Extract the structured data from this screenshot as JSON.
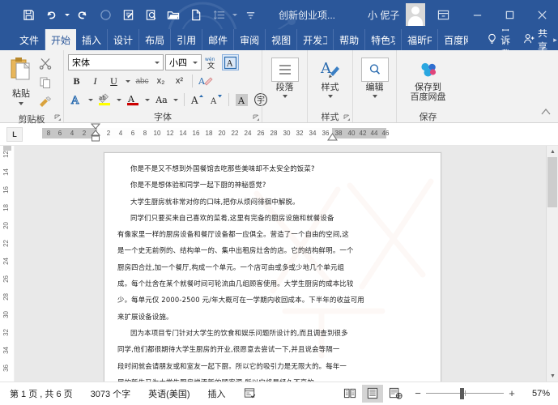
{
  "titlebar": {
    "quick_access": [
      {
        "name": "save-icon",
        "label": "保存"
      },
      {
        "name": "undo-icon",
        "label": "撤消"
      },
      {
        "name": "redo-icon",
        "label": "恢复"
      },
      {
        "name": "circle-icon",
        "label": "圆形"
      },
      {
        "name": "edit-doc-icon",
        "label": "编辑"
      },
      {
        "name": "print-preview-icon",
        "label": "打印预览"
      },
      {
        "name": "open-folder-icon",
        "label": "打开"
      },
      {
        "name": "new-doc-icon",
        "label": "新建"
      },
      {
        "name": "line-spacing-icon",
        "label": "行距"
      }
    ],
    "document_title": "创新创业项...",
    "user_name": "小 伲子",
    "avatar": "user-avatar",
    "ribbon_display_options": "ribbon-display-options-icon",
    "minimize": "−",
    "maximize": "□",
    "close": "✕"
  },
  "tabs": [
    {
      "label": "文件",
      "active": false
    },
    {
      "label": "开始",
      "active": true
    },
    {
      "label": "插入",
      "active": false
    },
    {
      "label": "设计",
      "active": false
    },
    {
      "label": "布局",
      "active": false
    },
    {
      "label": "引用",
      "active": false
    },
    {
      "label": "邮件",
      "active": false
    },
    {
      "label": "审阅",
      "active": false
    },
    {
      "label": "视图",
      "active": false
    },
    {
      "label": "开发工具",
      "active": false
    },
    {
      "label": "帮助",
      "active": false
    },
    {
      "label": "特色功能",
      "active": false
    },
    {
      "label": "福昕PDF",
      "active": false
    },
    {
      "label": "百度网盘",
      "active": false
    }
  ],
  "tell_me": {
    "icon": "lightbulb-icon",
    "label": "告诉我"
  },
  "share": {
    "icon": "share-person-icon",
    "label": "共享"
  },
  "ribbon": {
    "clipboard": {
      "group_label": "剪贴板",
      "paste_label": "粘贴",
      "cut": "cut-scissors-icon",
      "copy": "copy-icon",
      "format_painter": "format-painter-icon",
      "dialog_launcher": "dialog-launcher-icon"
    },
    "font": {
      "group_label": "字体",
      "font_name": "宋体",
      "font_size": "小四",
      "phonetic_guide": "phonetic-guide-icon",
      "enclose_char_border": "character-border-icon",
      "bold": "B",
      "italic": "I",
      "underline": "U",
      "strikethrough": "abc",
      "subscript": "x₂",
      "superscript": "x²",
      "clear_format": "clear-formatting-icon",
      "text_effects": "A",
      "highlight": "ab",
      "font_color": "A",
      "change_case": "Aa",
      "grow_font": "A",
      "shrink_font": "A",
      "char_shading": "A",
      "enclose_char": "字",
      "dialog_launcher": "dialog-launcher-icon"
    },
    "paragraph": {
      "group_label": "",
      "button_label": "段落",
      "icon": "paragraph-lines-icon"
    },
    "styles": {
      "group_label": "样式",
      "button_label": "样式",
      "icon": "styles-brush-icon",
      "dialog_launcher": "dialog-launcher-icon"
    },
    "editing": {
      "group_label": "",
      "button_label": "编辑",
      "icon": "magnifier-icon"
    },
    "save_group": {
      "group_label": "保存",
      "button_label": "保存到\n百度网盘",
      "button_label_line1": "保存到",
      "button_label_line2": "百度网盘",
      "icon": "baidu-netdisk-icon"
    },
    "collapse_ribbon": "collapse-ribbon-icon"
  },
  "ruler": {
    "tab_stop_marker": "L",
    "horizontal_ticks": [
      "8",
      "6",
      "4",
      "2",
      "2",
      "4",
      "6",
      "8",
      "10",
      "12",
      "14",
      "16",
      "18",
      "20",
      "22",
      "24",
      "26",
      "28",
      "30",
      "32",
      "34",
      "36",
      "38",
      "40",
      "42",
      "44",
      "46"
    ],
    "vertical_ticks": [
      "12",
      "14",
      "16",
      "18",
      "20",
      "22",
      "24",
      "26",
      "28",
      "30",
      "32",
      "34",
      "36"
    ]
  },
  "document": {
    "lines": [
      "你是不是又不想到外国餐馆去吃那些美味却不太安全的饭菜?",
      "你是不是想体验和同学一起下厨的神秘感觉?",
      "大学生厨房就非常对你的口味,把你从烦闷徘徊中解脱。",
      "同学们只要买来自己喜欢的菜肴,这里有完备的厨房设施和就餐设备",
      "有像家里一样的厨房设备和餐厅设备都一应俱全。营造了一个自由的空间,这",
      "是一个史无前例的、结构单一的、集中出租房灶舍的店。它的结构鲜明。一个",
      "厨房四合灶,加一个餐厅,构成一个单元。一个店可由或多或少地几个单元组",
      "成。每个灶舍在某个就餐时间可轮流由几组顾客使用。大学生厨房的成本比较",
      "少。每单元仅 2000-2500 元/年大概可在一学期内收回成本。下半年的收益可用",
      "来扩展设备设施。",
      "因为本项目专门针对大学生的饮食和娱乐问题所设计的,而且调查到很多",
      "同学,他们都很期待大学生厨房的开业,很愿意去尝试一下,并且说会等隔一",
      "段时间就会请朋友或和室友一起下厨。所以它的吸引力是无限大的。每年一",
      "届的新生又为大学生厨房增添新的顾客源,所以它将是经久不衰的。"
    ],
    "watermark": "文档水印"
  },
  "statusbar": {
    "page_info": "第 1 页 , 共 6 页",
    "word_count": "3073 个字",
    "language": "英语(美国)",
    "insert_mode": "插入",
    "proofing_icon": "proofing-errors-icon",
    "views": [
      {
        "name": "read-mode-icon",
        "selected": false
      },
      {
        "name": "print-layout-icon",
        "selected": true
      },
      {
        "name": "web-layout-icon",
        "selected": false
      }
    ],
    "zoom_out": "−",
    "zoom_in": "+",
    "zoom_percent": "57%"
  },
  "colors": {
    "title_blue": "#2b579a",
    "ribbon_bg": "#f2f2f2",
    "canvas_grey": "#e9e9e9",
    "accent_red": "#c00000",
    "highlight_yellow": "#ffff00"
  }
}
